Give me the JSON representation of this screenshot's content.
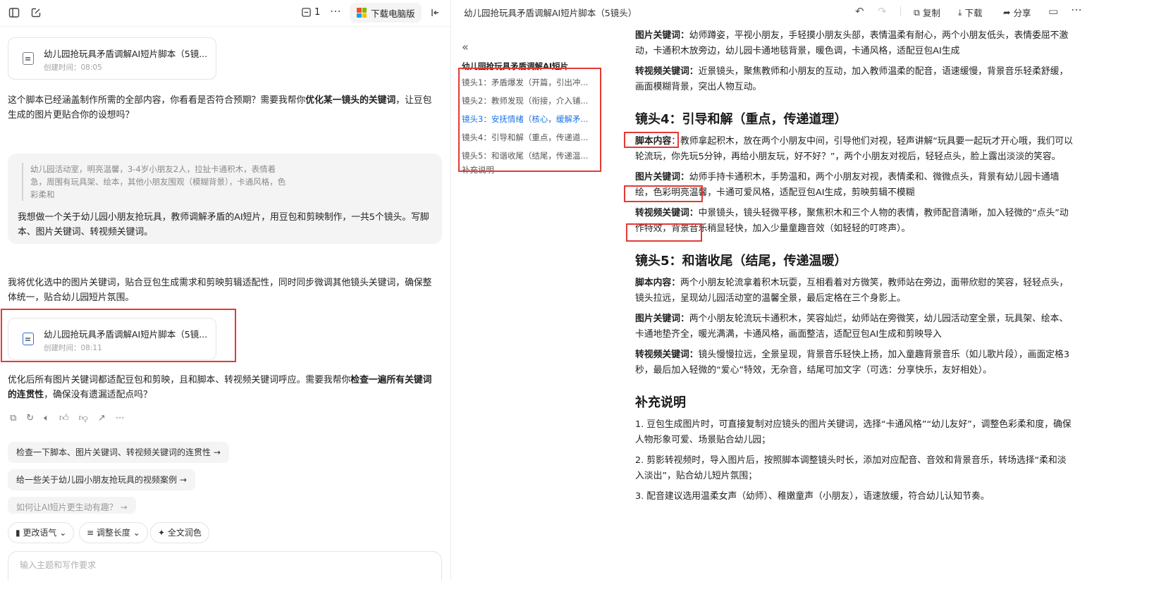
{
  "left": {
    "doc_count": "1",
    "download_label": "下载电脑版",
    "card1": {
      "title": "幼儿园抢玩具矛盾调解AI短片脚本（5镜...",
      "time": "创建时间：08:05"
    },
    "msg1_pre": "这个脚本已经涵盖制作所需的全部内容，你看看是否符合预期？需要我帮你",
    "msg1_bold": "优化某一镜头的关键词",
    "msg1_post": "，让豆包生成的图片更贴合你的设想吗？",
    "quote": "幼儿园活动室，明亮温馨，3-4岁小朋友2人，拉扯卡通积木，表情着急，周围有玩具架、绘本，其他小朋友围观（模糊背景），卡通风格，色彩柔和",
    "user_text": "我想做一个关于幼儿园小朋友抢玩具，教师调解矛盾的AI短片，用豆包和剪映制作，一共5个镜头。写脚本、图片关键词、转视频关键词。",
    "msg2": "我将优化选中的图片关键词，贴合豆包生成需求和剪映剪辑适配性，同时同步微调其他镜头关键词，确保整体统一，贴合幼儿园短片氛围。",
    "card2": {
      "title": "幼儿园抢玩具矛盾调解AI短片脚本（5镜...",
      "time": "创建时间：08:11"
    },
    "msg3_pre": "优化后所有图片关键词都适配豆包和剪映，且和脚本、转视频关键词呼应。需要我帮你",
    "msg3_bold": "检查一遍所有关键词的连贯性",
    "msg3_post": "，确保没有遗漏适配点吗？",
    "suggestions": [
      "检查一下脚本、图片关键词、转视频关键词的连贯性 →",
      "给一些关于幼儿园小朋友抢玩具的视频案例 →",
      "如何让AI短片更生动有趣？ →"
    ],
    "tools": [
      "更改语气",
      "调整长度",
      "全文润色"
    ],
    "input_placeholder": "输入主题和写作要求"
  },
  "right": {
    "title": "幼儿园抢玩具矛盾调解AI短片脚本（5镜头）",
    "actions": {
      "copy": "复制",
      "download": "下载",
      "share": "分享"
    },
    "toc_title": "幼儿园抢玩具矛盾调解AI短片",
    "toc": [
      "镜头1：矛盾爆发（开篇，引出冲...",
      "镜头2：教师发现（衔接，介入铺...",
      "镜头3：安抚情绪（核心，缓解矛...",
      "镜头4：引导和解（重点，传递道...",
      "镜头5：和谐收尾（结尾，传递温...",
      "补充说明"
    ],
    "s3_img_label": "图片关键词：",
    "s3_img": "幼师蹲姿，平视小朋友，手轻摸小朋友头部，表情温柔有耐心，两个小朋友低头，表情委屈不激动，卡通积木放旁边，幼儿园卡通地毯背景，暖色调，卡通风格，适配豆包AI生成",
    "s3_vid_label": "转视频关键词：",
    "s3_vid": "近景镜头，聚焦教师和小朋友的互动，加入教师温柔的配音，语速缓慢，背景音乐轻柔舒缓，画面模糊背景，突出人物互动。",
    "s4_heading": "镜头4：引导和解（重点，传递道理）",
    "s4_script_label": "脚本内容",
    "s4_script": "：教师拿起积木，放在两个小朋友中间，引导他们对视，轻声讲解“玩具要一起玩才开心哦，我们可以轮流玩，你先玩5分钟，再给小朋友玩，好不好？”，两个小朋友对视后，轻轻点头，脸上露出淡淡的笑容。",
    "s4_img_label": "图片关键词：",
    "s4_img": "幼师手持卡通积木，手势温和，两个小朋友对视，表情柔和、微微点头，背景有幼儿园卡通墙绘，色彩明亮温馨，卡通可爱风格，适配豆包AI生成，剪映剪辑不模糊",
    "s4_vid_label": "转视频关键词：",
    "s4_vid": "中景镜头，镜头轻微平移，聚焦积木和三个人物的表情，教师配音清晰，加入轻微的“点头”动作特效，背景音乐稍显轻快，加入少量童趣音效（如轻轻的叮咚声）。",
    "s5_heading": "镜头5：和谐收尾（结尾，传递温暖）",
    "s5_script_label": "脚本内容：",
    "s5_script": "两个小朋友轮流拿着积木玩耍，互相看着对方微笑，教师站在旁边，面带欣慰的笑容，轻轻点头，镜头拉远，呈现幼儿园活动室的温馨全景，最后定格在三个身影上。",
    "s5_img_label": "图片关键词：",
    "s5_img": "两个小朋友轮流玩卡通积木，笑容灿烂，幼师站在旁微笑，幼儿园活动室全景，玩具架、绘本、卡通地垫齐全，暖光满满，卡通风格，画面整洁，适配豆包AI生成和剪映导入",
    "s5_vid_label": "转视频关键词：",
    "s5_vid": "镜头慢慢拉远，全景呈现，背景音乐轻快上扬，加入童趣背景音乐（如儿歌片段），画面定格3秒，最后加入轻微的“爱心”特效，无杂音，结尾可加文字（可选：分享快乐，友好相处）。",
    "supp_heading": "补充说明",
    "supp": [
      "1. 豆包生成图片时，可直接复制对应镜头的图片关键词，选择“卡通风格”“幼儿友好”，调整色彩柔和度，确保人物形象可爱、场景贴合幼儿园；",
      "2. 剪影转视频时，导入图片后，按照脚本调整镜头时长，添加对应配音、音效和背景音乐，转场选择“柔和淡入淡出”，贴合幼儿短片氛围；",
      "3. 配音建议选用温柔女声（幼师）、稚嫩童声（小朋友），语速放缓，符合幼儿认知节奏。"
    ]
  }
}
